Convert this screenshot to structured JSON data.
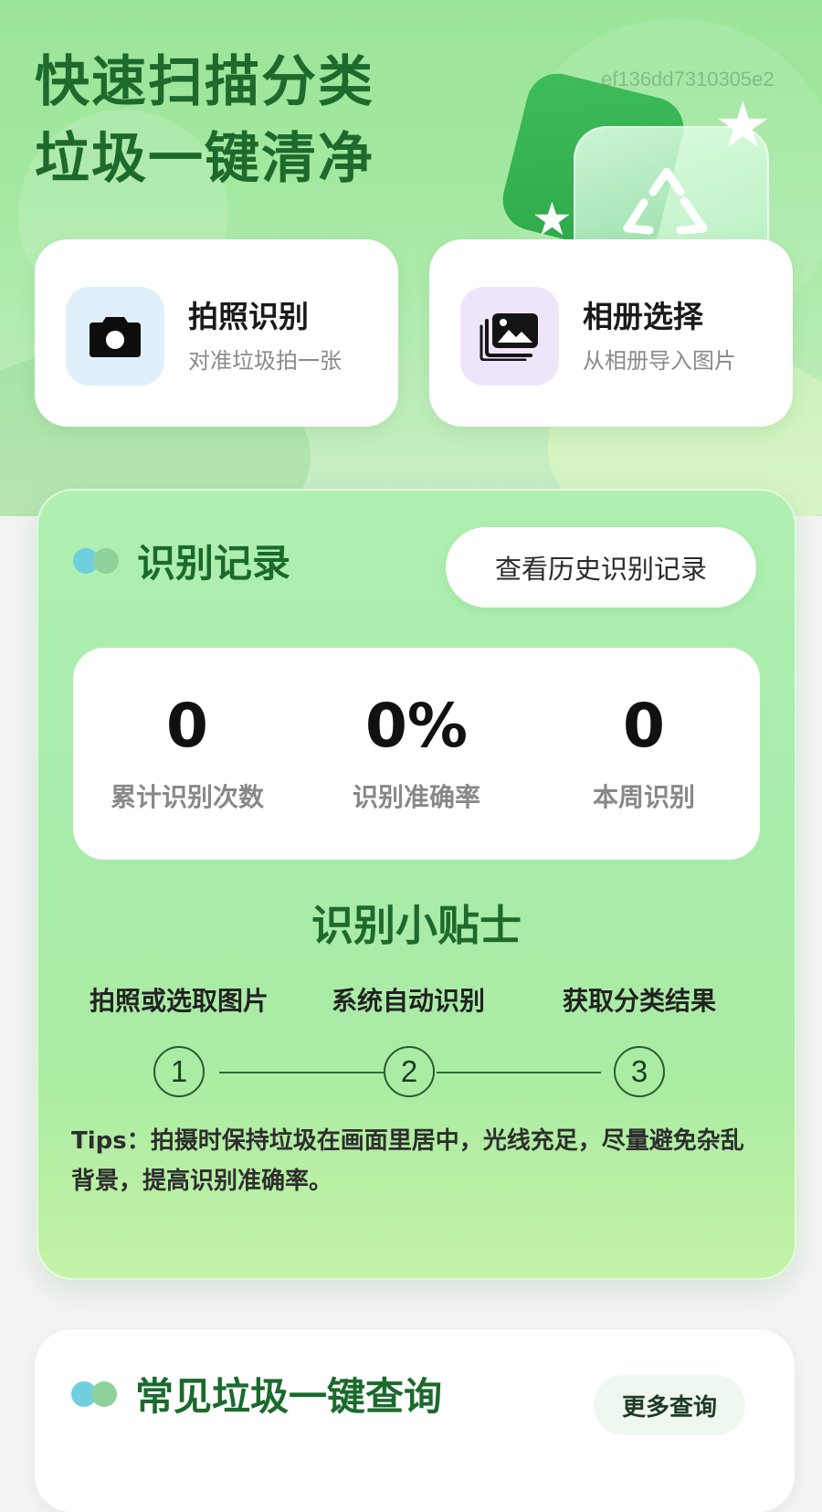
{
  "hero": {
    "title_line1": "快速扫描分类",
    "title_line2": "垃圾一键清净",
    "hash": "ef136dd7310305e2"
  },
  "actions": {
    "camera": {
      "title": "拍照识别",
      "subtitle": "对准垃圾拍一张",
      "icon": "camera-icon"
    },
    "album": {
      "title": "相册选择",
      "subtitle": "从相册导入图片",
      "icon": "gallery-icon"
    }
  },
  "records": {
    "title": "识别记录",
    "history_button": "查看历史识别记录",
    "stats": [
      {
        "value": "0",
        "label": "累计识别次数"
      },
      {
        "value": "0%",
        "label": "识别准确率"
      },
      {
        "value": "0",
        "label": "本周识别"
      }
    ]
  },
  "tips": {
    "title": "识别小贴士",
    "steps": [
      {
        "number": "1",
        "label": "拍照或选取图片"
      },
      {
        "number": "2",
        "label": "系统自动识别"
      },
      {
        "number": "3",
        "label": "获取分类结果"
      }
    ],
    "text": "Tips：拍摄时保持垃圾在画面里居中，光线充足，尽量避免杂乱背景，提高识别准确率。"
  },
  "common_query": {
    "title": "常见垃圾一键查询",
    "more_button": "更多查询"
  },
  "colors": {
    "primary_green": "#1d6a2c",
    "hero_bg": "#9be59a",
    "dot_blue": "#6fcfdf",
    "dot_green": "#8ed19a"
  }
}
